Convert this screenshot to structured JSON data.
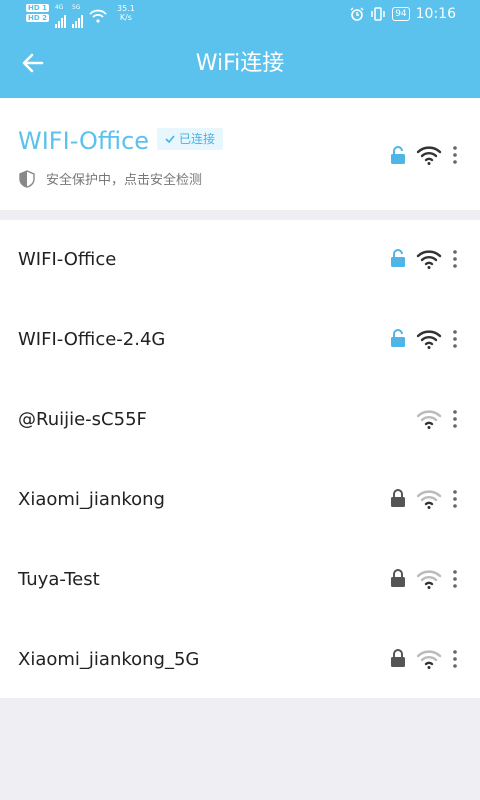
{
  "status_bar": {
    "sim1_badge": "HD 1",
    "sim2_badge": "HD 2",
    "net1_label": "4G",
    "net2_label": "5G",
    "speed_value": "35.1",
    "speed_unit": "K/s",
    "battery": "94",
    "time": "10:16"
  },
  "app_bar": {
    "title": "WiFi连接"
  },
  "current": {
    "name": "WIFI-Office",
    "badge": "已连接",
    "security_text": "安全保护中，点击安全检测"
  },
  "networks": [
    {
      "name": "WIFI-Office",
      "lock": "open",
      "signal": "strong"
    },
    {
      "name": "WIFI-Office-2.4G",
      "lock": "open",
      "signal": "strong"
    },
    {
      "name": "@Ruijie-sC55F",
      "lock": "none",
      "signal": "weak"
    },
    {
      "name": "Xiaomi_jiankong",
      "lock": "locked",
      "signal": "weak"
    },
    {
      "name": "Tuya-Test",
      "lock": "locked",
      "signal": "weak"
    },
    {
      "name": "Xiaomi_jiankong_5G",
      "lock": "locked",
      "signal": "weak"
    }
  ],
  "colors": {
    "accent": "#5bc1ed",
    "open_lock": "#4fb5e6",
    "closed_lock": "#555555",
    "signal_strong": "#333333",
    "signal_weak": "#aaaaaa"
  },
  "icons": {
    "back": "arrow-left-icon",
    "open_lock": "unlocked-padlock-icon",
    "closed_lock": "padlock-icon",
    "wifi": "wifi-signal-icon",
    "more": "vertical-ellipsis-icon",
    "shield": "shield-icon"
  }
}
